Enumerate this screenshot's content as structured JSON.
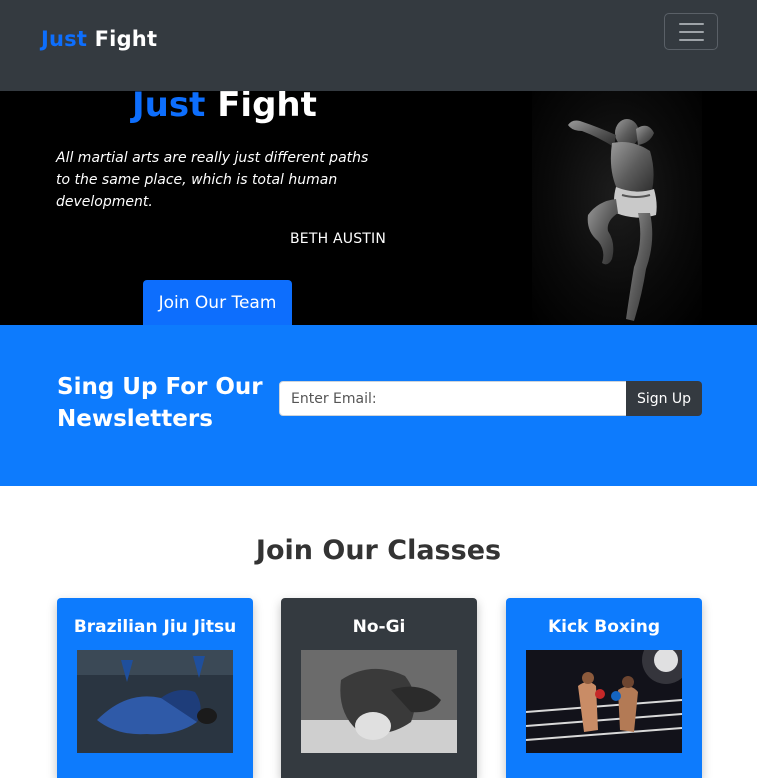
{
  "navbar": {
    "brand_part1": "Just",
    "brand_part2": "Fight",
    "toggler_icon": "hamburger-icon"
  },
  "hero": {
    "title_part1": "Just",
    "title_part2": "Fight",
    "quote": "All martial arts are really just different paths to the same place, which is total human development.",
    "author": "BETH AUSTIN",
    "cta_label": "Join Our Team"
  },
  "newsletter": {
    "title": "Sing Up For Our Newsletters",
    "email_placeholder": "Enter Email:",
    "email_value": "",
    "button_label": "Sign Up"
  },
  "classes": {
    "title": "Join Our Classes",
    "cards": [
      {
        "title": "Brazilian Jiu Jitsu"
      },
      {
        "title": "No-Gi"
      },
      {
        "title": "Kick Boxing"
      }
    ]
  },
  "colors": {
    "primary": "#0d6efd",
    "dark": "#343a40",
    "newsletter_bg": "#0d7bfd",
    "hero_bg": "#000000"
  }
}
